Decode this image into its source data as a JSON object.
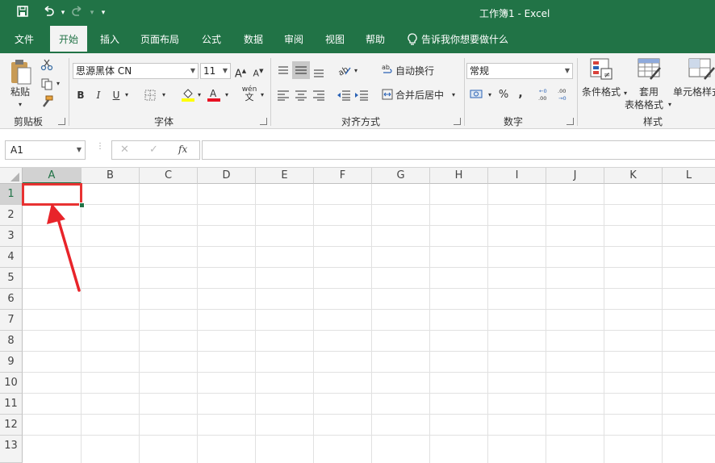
{
  "titlebar": {
    "title": "工作簿1  -  Excel",
    "qa_dropdown": "▾"
  },
  "tabs": [
    "文件",
    "开始",
    "插入",
    "页面布局",
    "公式",
    "数据",
    "审阅",
    "视图",
    "帮助"
  ],
  "tell_me": "告诉我你想要做什么",
  "ribbon": {
    "clipboard": {
      "paste": "粘贴",
      "group": "剪贴板"
    },
    "font": {
      "name": "思源黑体 CN",
      "size": "11",
      "bold": "B",
      "italic": "I",
      "underline": "U",
      "phonetic": "wén",
      "group": "字体"
    },
    "alignment": {
      "wrap": "自动换行",
      "merge": "合并后居中",
      "group": "对齐方式"
    },
    "number": {
      "format": "常规",
      "percent": "%",
      "comma": ",",
      "group": "数字"
    },
    "styles": {
      "conditional": "条件格式",
      "table_format_1": "套用",
      "table_format_2": "表格格式",
      "cell_styles": "单元格样式",
      "group": "样式"
    }
  },
  "formula_bar": {
    "name_box": "A1",
    "cancel": "✕",
    "enter": "✓",
    "fx": "fx",
    "value": ""
  },
  "grid": {
    "columns": [
      "A",
      "B",
      "C",
      "D",
      "E",
      "F",
      "G",
      "H",
      "I",
      "J",
      "K",
      "L"
    ],
    "rows": [
      "1",
      "2",
      "3",
      "4",
      "5",
      "6",
      "7",
      "8",
      "9",
      "10",
      "11",
      "12",
      "13"
    ],
    "selected_cell": "A1"
  },
  "colors": {
    "brand": "#217346",
    "highlight": "#e83232",
    "annotation": "#e8242a"
  }
}
